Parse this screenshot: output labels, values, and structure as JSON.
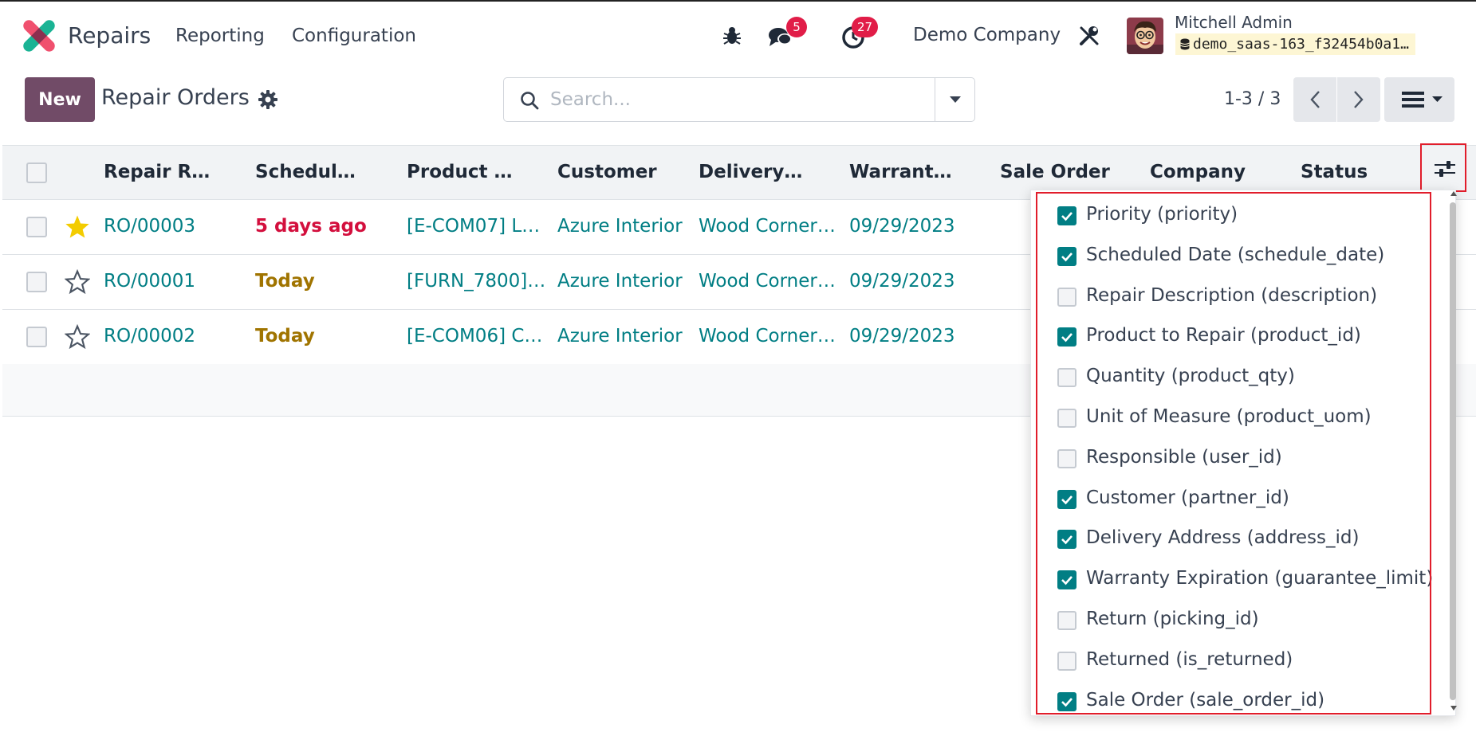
{
  "topbar": {
    "app_name": "Repairs",
    "menus": [
      "Reporting",
      "Configuration"
    ],
    "messages_count": "5",
    "activities_count": "27",
    "company": "Demo Company",
    "user_name": "Mitchell Admin",
    "database": "demo_saas-163_f32454b0a1…"
  },
  "control_panel": {
    "new_label": "New",
    "title": "Repair Orders",
    "search_placeholder": "Search...",
    "pager": "1-3 / 3"
  },
  "list": {
    "headers": [
      "Repair R…",
      "Schedul…",
      "Product …",
      "Customer",
      "Delivery…",
      "Warrant…",
      "Sale Order",
      "Company",
      "Status"
    ],
    "rows": [
      {
        "starred": true,
        "ref": "RO/00003",
        "scheduled": "5 days ago",
        "scheduled_color": "#d30f3d",
        "product": "[E-COM07] L…",
        "customer": "Azure Interior",
        "delivery": "Wood Corner…",
        "warranty": "09/29/2023"
      },
      {
        "starred": false,
        "ref": "RO/00001",
        "scheduled": "Today",
        "scheduled_color": "#a07400",
        "product": "[FURN_7800]…",
        "customer": "Azure Interior",
        "delivery": "Wood Corner…",
        "warranty": "09/29/2023"
      },
      {
        "starred": false,
        "ref": "RO/00002",
        "scheduled": "Today",
        "scheduled_color": "#a07400",
        "product": "[E-COM06] C…",
        "customer": "Azure Interior",
        "delivery": "Wood Corner…",
        "warranty": "09/29/2023"
      }
    ]
  },
  "optional_columns": [
    {
      "label": "Priority (priority)",
      "checked": true
    },
    {
      "label": "Scheduled Date (schedule_date)",
      "checked": true
    },
    {
      "label": "Repair Description (description)",
      "checked": false
    },
    {
      "label": "Product to Repair (product_id)",
      "checked": true
    },
    {
      "label": "Quantity (product_qty)",
      "checked": false
    },
    {
      "label": "Unit of Measure (product_uom)",
      "checked": false
    },
    {
      "label": "Responsible (user_id)",
      "checked": false
    },
    {
      "label": "Customer (partner_id)",
      "checked": true
    },
    {
      "label": "Delivery Address (address_id)",
      "checked": true
    },
    {
      "label": "Warranty Expiration (guarantee_limit)",
      "checked": true
    },
    {
      "label": "Return (picking_id)",
      "checked": false
    },
    {
      "label": "Returned (is_returned)",
      "checked": false
    },
    {
      "label": "Sale Order (sale_order_id)",
      "checked": true
    }
  ],
  "colors": {
    "brand": "#714b67",
    "link": "#017e84",
    "badge": "#e11d48",
    "highlight": "#e11d2b"
  }
}
